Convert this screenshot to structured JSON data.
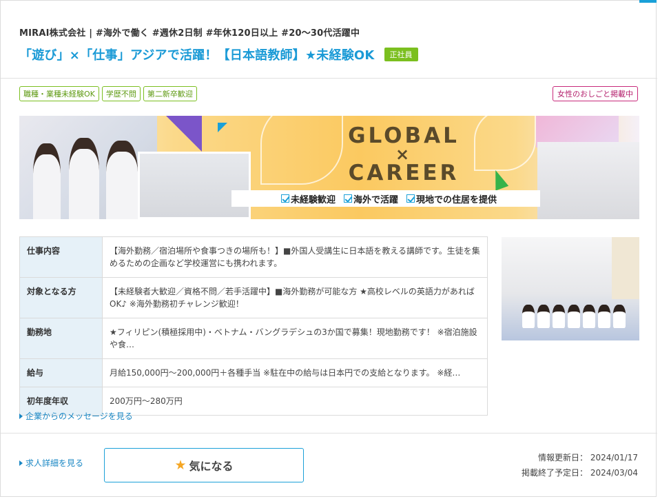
{
  "header": {
    "company_tags": "MIRAI株式会社 | #海外で働く #週休2日制 #年休120日以上 #20～30代活躍中",
    "job_title": "「遊び」×「仕事」アジアで活躍！【日本語教師】★未経験OK",
    "employment_badge": "正社員"
  },
  "tags": [
    "職種・業種未経験OK",
    "学歴不問",
    "第二新卒歓迎"
  ],
  "women_tag": "女性のおしごと掲載中",
  "banner": {
    "title_line1": "GLOBAL",
    "title_cross": "×",
    "title_line2": "CAREER",
    "checks": [
      "未経験歓迎",
      "海外で活躍",
      "現地での住居を提供"
    ]
  },
  "details": [
    {
      "label": "仕事内容",
      "value": "【海外勤務／宿泊場所や食事つきの場所も！】■外国人受講生に日本語を教える講師です。生徒を集めるための企画など学校運営にも携われます。"
    },
    {
      "label": "対象となる方",
      "value": "【未経験者大歓迎／資格不問／若手活躍中】■海外勤務が可能な方 ★高校レベルの英語力があればOK♪ ※海外勤務初チャレンジ歓迎！"
    },
    {
      "label": "勤務地",
      "value": "★フィリピン(積極採用中)・ベトナム・バングラデシュの3か国で募集！現地勤務です！ ※宿泊施設や食…"
    },
    {
      "label": "給与",
      "value": "月給150,000円～200,000円＋各種手当 ※駐在中の給与は日本円での支給となります。 ※経…"
    },
    {
      "label": "初年度年収",
      "value": "200万円～280万円"
    }
  ],
  "links": {
    "company_message": "企業からのメッセージを見る",
    "job_detail": "求人詳細を見る"
  },
  "actions": {
    "favorite_label": "気になる"
  },
  "dates": {
    "updated_label": "情報更新日：",
    "updated_value": "2024/01/17",
    "end_label": "掲載終了予定日：",
    "end_value": "2024/03/04"
  },
  "colors": {
    "accent": "#1aa0d8",
    "badge_green": "#7bbf1f",
    "women_tag": "#c8287a",
    "star": "#f5a623"
  }
}
